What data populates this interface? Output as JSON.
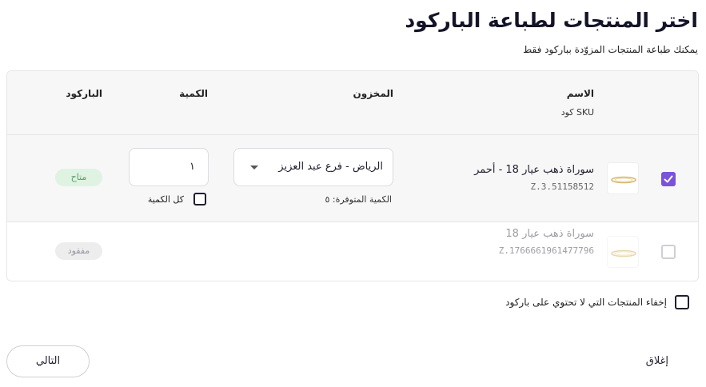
{
  "header": {
    "title": "اختر المنتجات لطباعة الباركود",
    "subtitle": "يمكنك طباعة المنتجات المزوّدة بباركود فقط"
  },
  "table": {
    "columns": {
      "name": "الاسم",
      "sku": "كود SKU",
      "warehouse": "المخزون",
      "quantity": "الكمية",
      "barcode": "الباركود"
    },
    "rows": [
      {
        "selected": true,
        "name": "سوراة ذهب عيار 18 - أحمر",
        "sku": "Z.3.51158512",
        "warehouse": "الرياض - فرع عبد العزيز",
        "available_qty": "الكمية المتوفرة: ٥",
        "quantity": "١",
        "all_qty_label": "كل الكمية",
        "all_qty_checked": false,
        "status": "متاح"
      },
      {
        "selected": false,
        "name": "سوراة ذهب عيار 18",
        "sku": "Z.1766661961477796",
        "status": "مفقود"
      }
    ]
  },
  "options": {
    "hide_without_barcode_label": "إخفاء المنتجات التي لا تحتوي على باركود",
    "hide_without_barcode_checked": false
  },
  "footer": {
    "next_label": "التالي",
    "close_label": "إغلاق"
  },
  "colors": {
    "accent": "#7b52dc",
    "available_badge_bg": "#dff3e2",
    "available_badge_text": "#5a9a66",
    "missing_badge_bg": "#ededee"
  }
}
